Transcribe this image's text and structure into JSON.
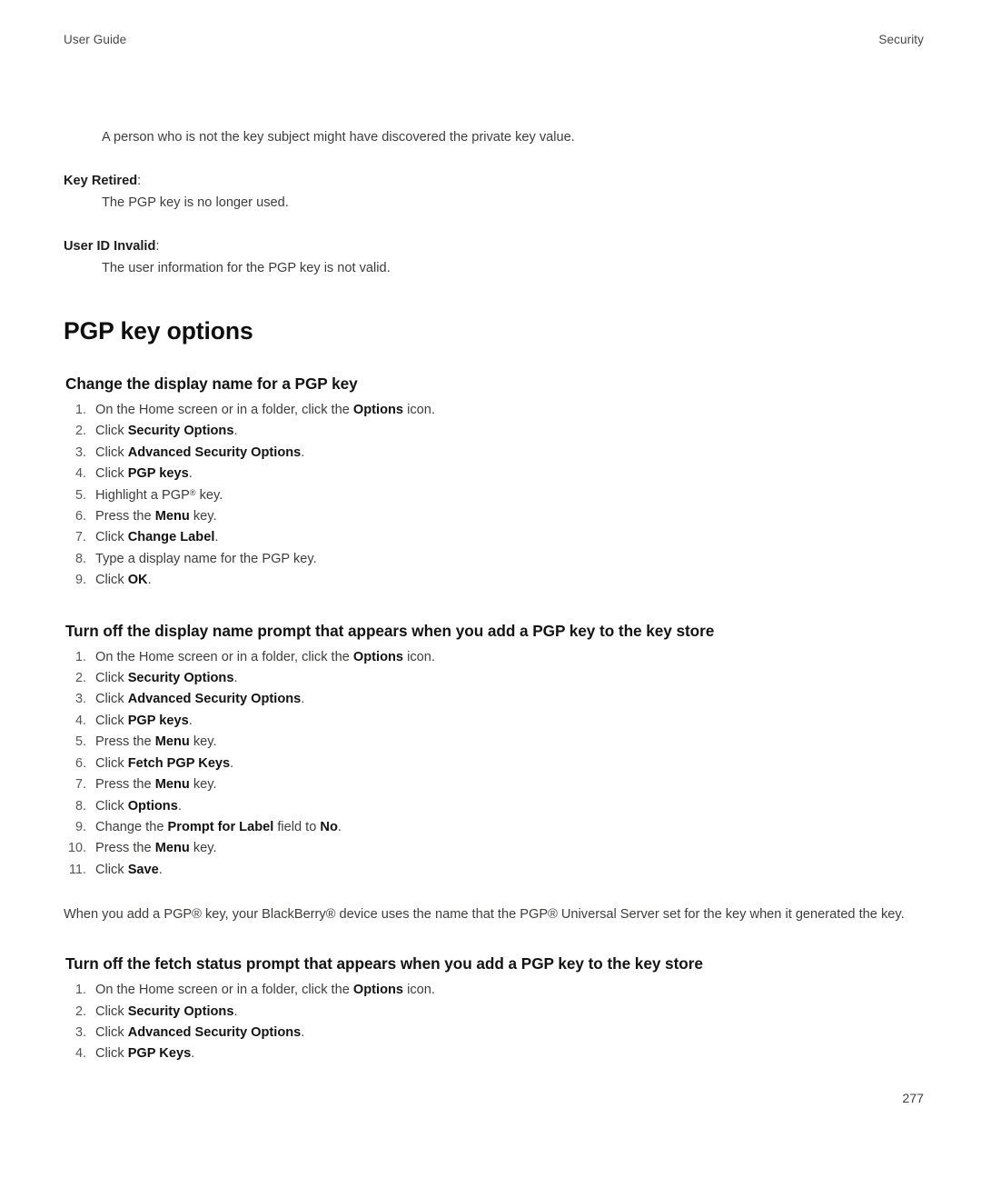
{
  "header": {
    "left": "User Guide",
    "right": "Security"
  },
  "body": {
    "intro_line": "A person who is not the key subject might have discovered the private key value.",
    "definitions": [
      {
        "term": "Key Retired",
        "colon": ":",
        "description": "The PGP key is no longer used."
      },
      {
        "term": "User ID Invalid",
        "colon": ":",
        "description": "The user information for the PGP key is not valid."
      }
    ],
    "section_title": "PGP key options",
    "procedures": [
      {
        "heading": "Change the display name for a PGP key",
        "steps": [
          {
            "pre": "On the Home screen or in a folder, click the ",
            "bold": "Options",
            "post": " icon."
          },
          {
            "pre": "Click ",
            "bold": "Security Options",
            "post": "."
          },
          {
            "pre": "Click ",
            "bold": "Advanced Security Options",
            "post": "."
          },
          {
            "pre": "Click ",
            "bold": "PGP keys",
            "post": "."
          },
          {
            "pre": "Highlight a PGP",
            "reg": true,
            "bold": "",
            "post": " key."
          },
          {
            "pre": "Press the ",
            "bold": "Menu",
            "post": " key."
          },
          {
            "pre": "Click ",
            "bold": "Change Label",
            "post": "."
          },
          {
            "pre": "Type a display name for the PGP key.",
            "bold": "",
            "post": ""
          },
          {
            "pre": "Click ",
            "bold": "OK",
            "post": "."
          }
        ]
      },
      {
        "heading": "Turn off the display name prompt that appears when you add a PGP key to the key store",
        "steps": [
          {
            "pre": "On the Home screen or in a folder, click the ",
            "bold": "Options",
            "post": " icon."
          },
          {
            "pre": "Click ",
            "bold": "Security Options",
            "post": "."
          },
          {
            "pre": "Click ",
            "bold": "Advanced Security Options",
            "post": "."
          },
          {
            "pre": "Click ",
            "bold": "PGP keys",
            "post": "."
          },
          {
            "pre": "Press the ",
            "bold": "Menu",
            "post": " key."
          },
          {
            "pre": "Click ",
            "bold": "Fetch PGP Keys",
            "post": "."
          },
          {
            "pre": "Press the ",
            "bold": "Menu",
            "post": " key."
          },
          {
            "pre": "Click ",
            "bold": "Options",
            "post": "."
          },
          {
            "pre": "Change the ",
            "bold": "Prompt for Label",
            "mid": " field to ",
            "bold2": "No",
            "post": "."
          },
          {
            "pre": "Press the ",
            "bold": "Menu",
            "post": " key."
          },
          {
            "pre": "Click ",
            "bold": "Save",
            "post": "."
          }
        ],
        "note": "When you add a PGP® key, your BlackBerry® device uses the name that the PGP® Universal Server set for the key when it generated the key."
      },
      {
        "heading": "Turn off the fetch status prompt that appears when you add a PGP key to the key store",
        "steps": [
          {
            "pre": "On the Home screen or in a folder, click the ",
            "bold": "Options",
            "post": " icon."
          },
          {
            "pre": "Click ",
            "bold": "Security Options",
            "post": "."
          },
          {
            "pre": "Click ",
            "bold": "Advanced Security Options",
            "post": "."
          },
          {
            "pre": "Click ",
            "bold": "PGP Keys",
            "post": "."
          }
        ]
      }
    ]
  },
  "footer": {
    "page_number": "277"
  }
}
